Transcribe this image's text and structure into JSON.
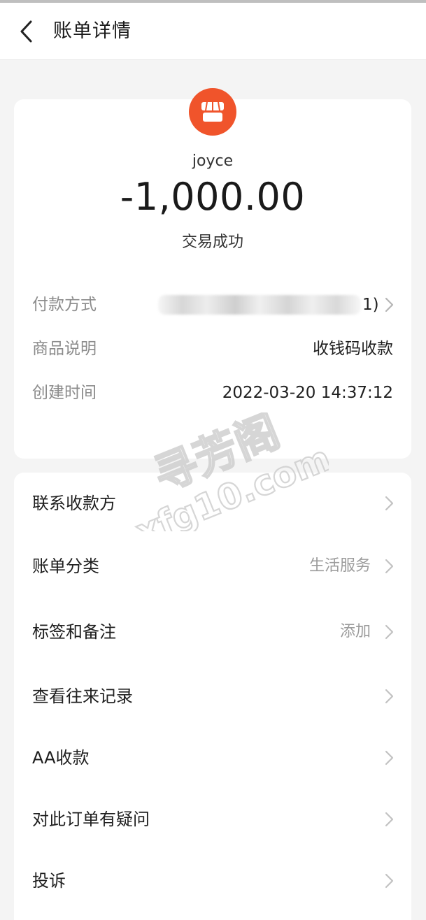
{
  "header": {
    "title": "账单详情",
    "back_icon": "chevron-left-icon"
  },
  "summary": {
    "logo_icon": "storefront-icon",
    "logo_color": "#f0542b",
    "merchant_name": "joyce",
    "amount": "-1,000.00",
    "status": "交易成功"
  },
  "details": [
    {
      "label": "付款方式",
      "value": "1)",
      "blurred": true
    },
    {
      "label": "商品说明",
      "value": "收钱码收款"
    },
    {
      "label": "创建时间",
      "value": "2022-03-20 14:37:12"
    }
  ],
  "menu": [
    {
      "label": "联系收款方",
      "value": ""
    },
    {
      "label": "账单分类",
      "value": "生活服务"
    },
    {
      "label": "标签和备注",
      "value": "添加"
    },
    {
      "label": "查看往来记录",
      "value": ""
    },
    {
      "label": "AA收款",
      "value": ""
    },
    {
      "label": "对此订单有疑问",
      "value": ""
    },
    {
      "label": "投诉",
      "value": ""
    }
  ],
  "watermark": {
    "line1": "寻芳阁",
    "line2": "xfg10.com"
  }
}
